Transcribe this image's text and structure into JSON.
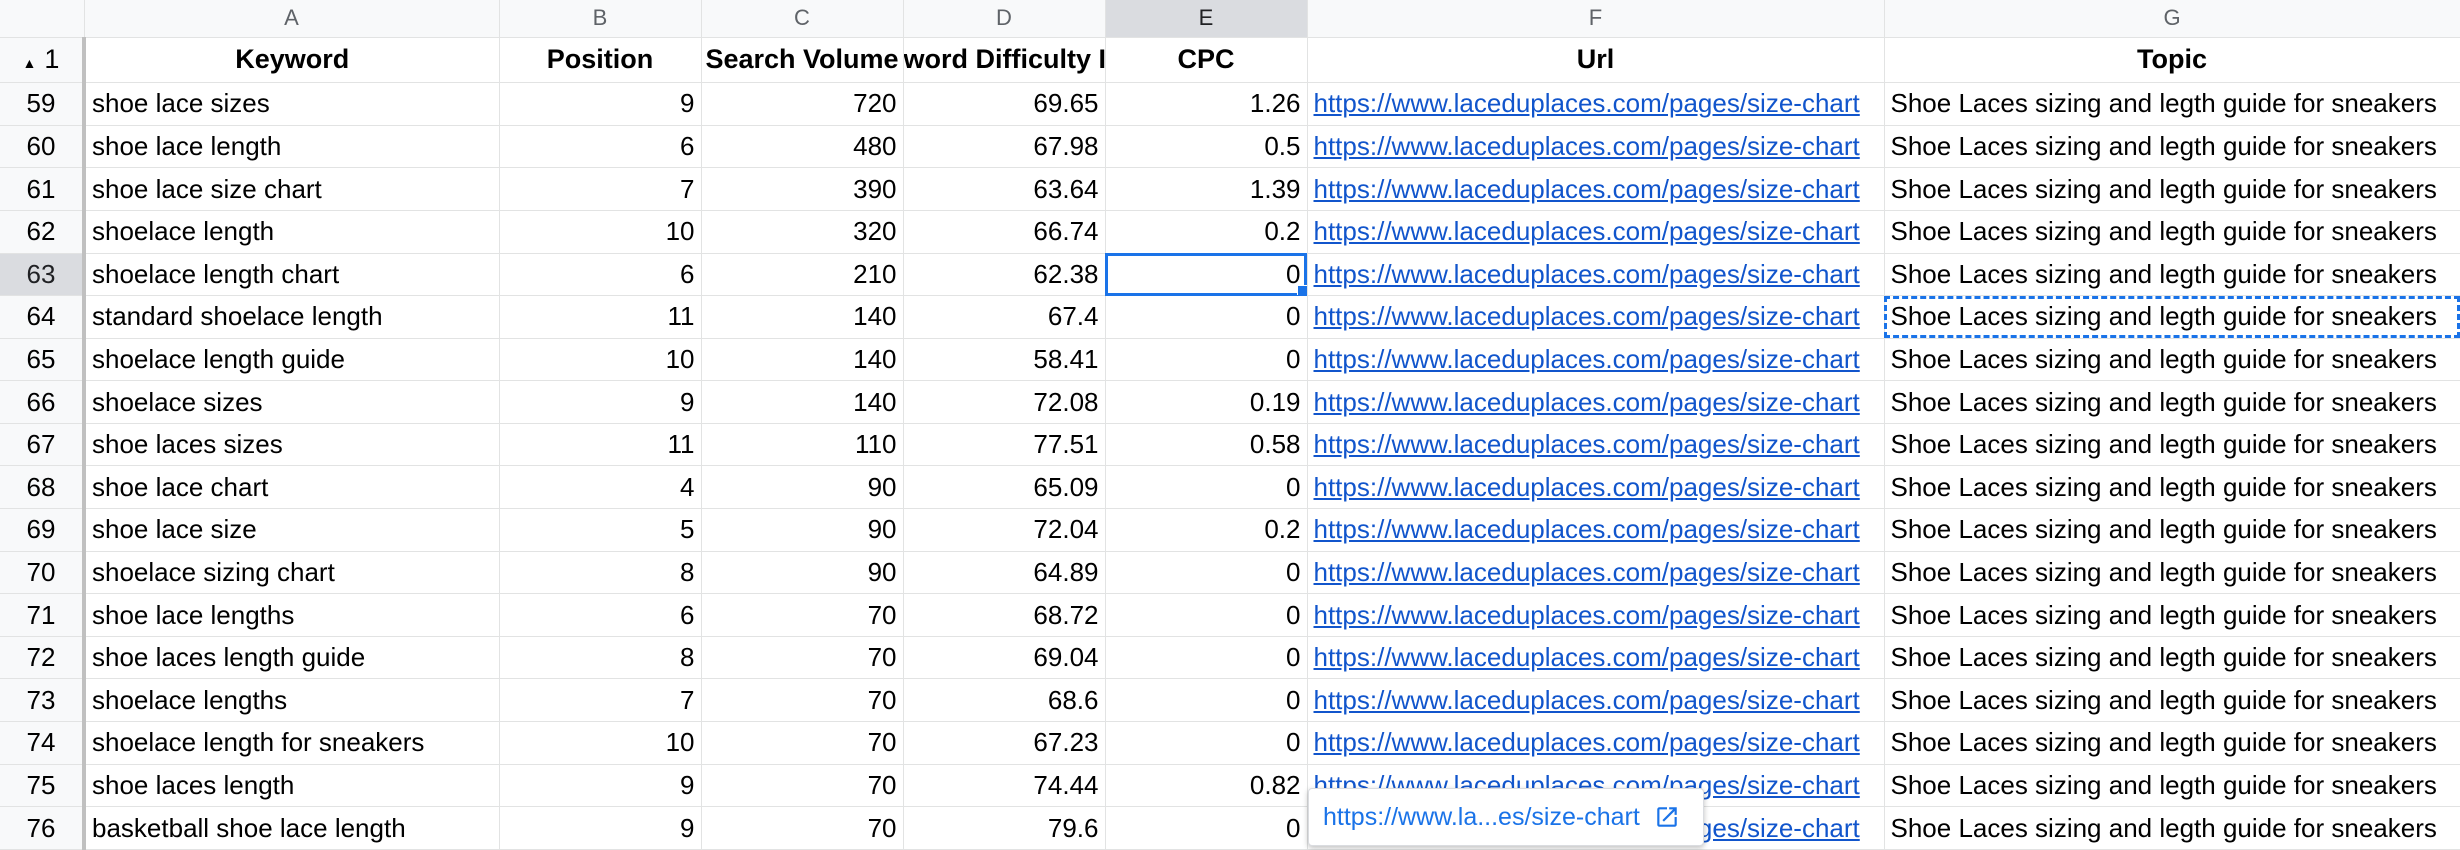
{
  "column_letters": [
    "A",
    "B",
    "C",
    "D",
    "E",
    "F",
    "G"
  ],
  "header_row": {
    "row_number": "1",
    "cells": [
      "Keyword",
      "Position",
      "Search Volume",
      "word Difficulty In",
      "CPC",
      "Url",
      "Topic"
    ]
  },
  "rows": [
    {
      "n": "59",
      "keyword": "shoe lace sizes",
      "position": "9",
      "volume": "720",
      "difficulty": "69.65",
      "cpc": "1.26",
      "url": "https://www.laceduplaces.com/pages/size-chart",
      "topic": "Shoe Laces sizing and legth guide for sneakers"
    },
    {
      "n": "60",
      "keyword": "shoe lace length",
      "position": "6",
      "volume": "480",
      "difficulty": "67.98",
      "cpc": "0.5",
      "url": "https://www.laceduplaces.com/pages/size-chart",
      "topic": "Shoe Laces sizing and legth guide for sneakers"
    },
    {
      "n": "61",
      "keyword": "shoe lace size chart",
      "position": "7",
      "volume": "390",
      "difficulty": "63.64",
      "cpc": "1.39",
      "url": "https://www.laceduplaces.com/pages/size-chart",
      "topic": "Shoe Laces sizing and legth guide for sneakers"
    },
    {
      "n": "62",
      "keyword": "shoelace length",
      "position": "10",
      "volume": "320",
      "difficulty": "66.74",
      "cpc": "0.2",
      "url": "https://www.laceduplaces.com/pages/size-chart",
      "topic": "Shoe Laces sizing and legth guide for sneakers"
    },
    {
      "n": "63",
      "keyword": "shoelace length chart",
      "position": "6",
      "volume": "210",
      "difficulty": "62.38",
      "cpc": "0",
      "url": "https://www.laceduplaces.com/pages/size-chart",
      "topic": "Shoe Laces sizing and legth guide for sneakers"
    },
    {
      "n": "64",
      "keyword": "standard shoelace length",
      "position": "11",
      "volume": "140",
      "difficulty": "67.4",
      "cpc": "0",
      "url": "https://www.laceduplaces.com/pages/size-chart",
      "topic": "Shoe Laces sizing and legth guide for sneakers"
    },
    {
      "n": "65",
      "keyword": "shoelace length guide",
      "position": "10",
      "volume": "140",
      "difficulty": "58.41",
      "cpc": "0",
      "url": "https://www.laceduplaces.com/pages/size-chart",
      "topic": "Shoe Laces sizing and legth guide for sneakers"
    },
    {
      "n": "66",
      "keyword": "shoelace sizes",
      "position": "9",
      "volume": "140",
      "difficulty": "72.08",
      "cpc": "0.19",
      "url": "https://www.laceduplaces.com/pages/size-chart",
      "topic": "Shoe Laces sizing and legth guide for sneakers"
    },
    {
      "n": "67",
      "keyword": "shoe laces sizes",
      "position": "11",
      "volume": "110",
      "difficulty": "77.51",
      "cpc": "0.58",
      "url": "https://www.laceduplaces.com/pages/size-chart",
      "topic": "Shoe Laces sizing and legth guide for sneakers"
    },
    {
      "n": "68",
      "keyword": "shoe lace chart",
      "position": "4",
      "volume": "90",
      "difficulty": "65.09",
      "cpc": "0",
      "url": "https://www.laceduplaces.com/pages/size-chart",
      "topic": "Shoe Laces sizing and legth guide for sneakers"
    },
    {
      "n": "69",
      "keyword": "shoe lace size",
      "position": "5",
      "volume": "90",
      "difficulty": "72.04",
      "cpc": "0.2",
      "url": "https://www.laceduplaces.com/pages/size-chart",
      "topic": "Shoe Laces sizing and legth guide for sneakers"
    },
    {
      "n": "70",
      "keyword": "shoelace sizing chart",
      "position": "8",
      "volume": "90",
      "difficulty": "64.89",
      "cpc": "0",
      "url": "https://www.laceduplaces.com/pages/size-chart",
      "topic": "Shoe Laces sizing and legth guide for sneakers"
    },
    {
      "n": "71",
      "keyword": "shoe lace lengths",
      "position": "6",
      "volume": "70",
      "difficulty": "68.72",
      "cpc": "0",
      "url": "https://www.laceduplaces.com/pages/size-chart",
      "topic": "Shoe Laces sizing and legth guide for sneakers"
    },
    {
      "n": "72",
      "keyword": "shoe laces length guide",
      "position": "8",
      "volume": "70",
      "difficulty": "69.04",
      "cpc": "0",
      "url": "https://www.laceduplaces.com/pages/size-chart",
      "topic": "Shoe Laces sizing and legth guide for sneakers"
    },
    {
      "n": "73",
      "keyword": "shoelace lengths",
      "position": "7",
      "volume": "70",
      "difficulty": "68.6",
      "cpc": "0",
      "url": "https://www.laceduplaces.com/pages/size-chart",
      "topic": "Shoe Laces sizing and legth guide for sneakers"
    },
    {
      "n": "74",
      "keyword": "shoelace length for sneakers",
      "position": "10",
      "volume": "70",
      "difficulty": "67.23",
      "cpc": "0",
      "url": "https://www.laceduplaces.com/pages/size-chart",
      "topic": "Shoe Laces sizing and legth guide for sneakers"
    },
    {
      "n": "75",
      "keyword": "shoe laces length",
      "position": "9",
      "volume": "70",
      "difficulty": "74.44",
      "cpc": "0.82",
      "url": "https://www.laceduplaces.com/pages/size-chart",
      "topic": "Shoe Laces sizing and legth guide for sneakers"
    },
    {
      "n": "76",
      "keyword": "basketball shoe lace length",
      "position": "9",
      "volume": "70",
      "difficulty": "79.6",
      "cpc": "0",
      "url": "https://www.laceduplaces.com/pages/size-chart",
      "topic": "Shoe Laces sizing and legth guide for sneakers"
    }
  ],
  "selection": {
    "active_cell_row": "63",
    "active_column": "E",
    "copied_cell_row": "64",
    "copied_column": "G"
  },
  "link_chip": {
    "text": "https://www.la...es/size-chart",
    "icon": "open-in-new-icon"
  },
  "colors": {
    "link": "#1155cc",
    "selection": "#1a73e8",
    "header_bg": "#f8f9fa"
  }
}
